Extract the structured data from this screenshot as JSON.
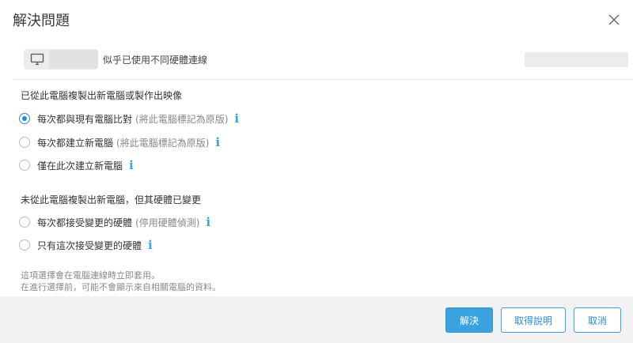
{
  "dialog": {
    "title": "解決問題"
  },
  "machine": {
    "message": "似乎已使用不同硬體連線"
  },
  "section1": {
    "title": "已從此電腦複製出新電腦或製作出映像",
    "options": [
      {
        "label": "每次都與現有電腦比對",
        "hint": "(將此電腦標記為原版)",
        "checked": true
      },
      {
        "label": "每次都建立新電腦",
        "hint": "(將此電腦標記為原版)",
        "checked": false
      },
      {
        "label": "僅在此次建立新電腦",
        "hint": "",
        "checked": false
      }
    ]
  },
  "section2": {
    "title": "未從此電腦複製出新電腦，但其硬體已變更",
    "options": [
      {
        "label": "每次都接受變更的硬體",
        "hint": "(停用硬體偵測)",
        "checked": false
      },
      {
        "label": "只有這次接受變更的硬體",
        "hint": "",
        "checked": false
      }
    ]
  },
  "notes": {
    "line1": "這項選擇會在電腦連線時立即套用。",
    "line2": "在進行選擇前，可能不會顯示來自相關電腦的資料。"
  },
  "buttons": {
    "resolve": "解決",
    "help": "取得說明",
    "cancel": "取消"
  },
  "icons": {
    "info": "i",
    "monitor": "monitor-icon",
    "close": "close-icon"
  },
  "colors": {
    "accent": "#3aa3df",
    "radio_checked": "#2a8ad4"
  }
}
